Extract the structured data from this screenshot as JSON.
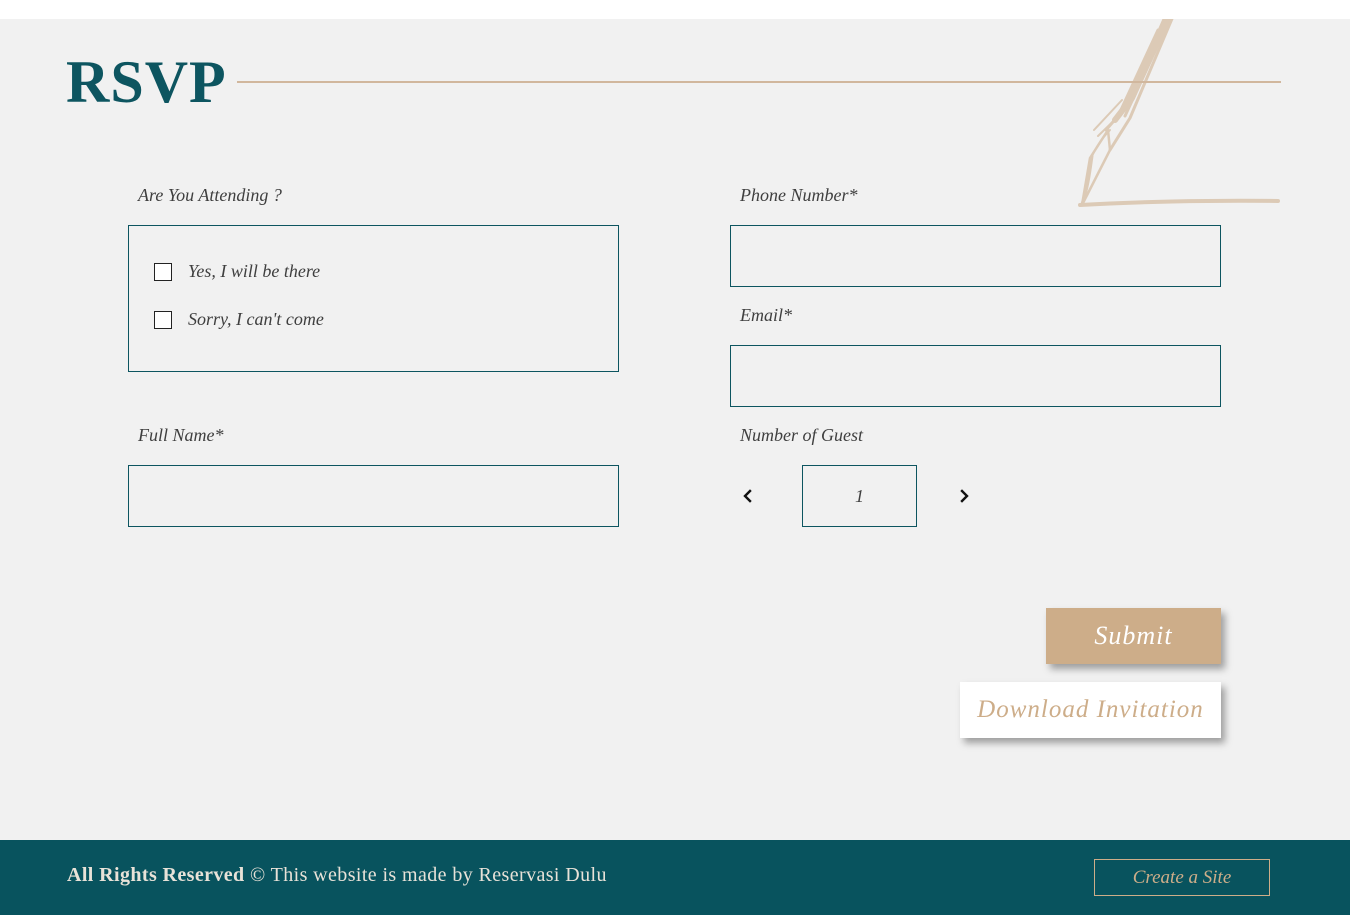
{
  "header": {
    "title": "RSVP"
  },
  "form": {
    "attending": {
      "label": "Are You Attending ?",
      "options": [
        {
          "label": "Yes, I will be there",
          "checked": false
        },
        {
          "label": "Sorry, I can't come",
          "checked": false
        }
      ]
    },
    "full_name": {
      "label": "Full Name*",
      "value": ""
    },
    "phone": {
      "label": "Phone Number*",
      "value": ""
    },
    "email": {
      "label": "Email*",
      "value": ""
    },
    "guests": {
      "label": "Number of Guest",
      "value": "1",
      "prev_icon": "chevron-left-icon",
      "next_icon": "chevron-right-icon"
    },
    "submit_label": "Submit",
    "download_label": "Download Invitation"
  },
  "footer": {
    "rights_bold": "All Rights Reserved",
    "rights_rest": " © This website is made by Reservasi Dulu",
    "create_site_label": "Create a Site"
  },
  "decoration": {
    "icon": "pen-drawing-icon"
  },
  "colors": {
    "primary": "#0d5560",
    "accent": "#cdad89",
    "background": "#f1f1f1",
    "footer": "#08535e"
  }
}
